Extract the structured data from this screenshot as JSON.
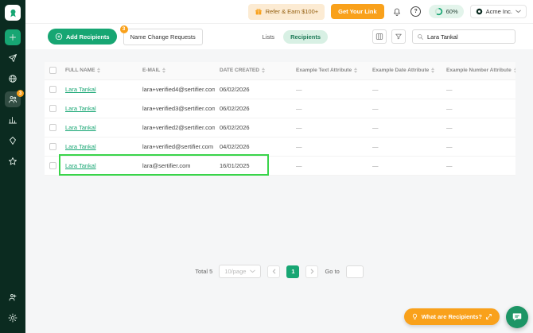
{
  "sidebar": {
    "icons": [
      "logo",
      "add",
      "send",
      "globe",
      "recipients",
      "analytics",
      "credentials",
      "star",
      "invite",
      "settings"
    ],
    "recipients_badge": "3"
  },
  "header": {
    "refer_button": "Refer & Earn $100+",
    "get_link_button": "Get Your Link",
    "help_icon": "?",
    "usage_percent": "60%",
    "org_name": "Acme Inc."
  },
  "toolbar": {
    "add_recipients": "Add Recipients",
    "name_change_requests": "Name Change Requests",
    "name_change_badge": "3",
    "tab_lists": "Lists",
    "tab_recipients": "Recipients",
    "search_value": "Lara Tankal"
  },
  "table": {
    "columns": [
      "FULL NAME",
      "E-MAIL",
      "DATE CREATED",
      "Example Text Attribute",
      "Example Date Attribute",
      "Example Number Attribute"
    ],
    "rows": [
      {
        "name": "Lara Tankal",
        "email": "lara+verified4@sertifier.com",
        "date": "06/02/2026",
        "text_attr": "—",
        "date_attr": "—",
        "number_attr": "—"
      },
      {
        "name": "Lara Tankal",
        "email": "lara+verified3@sertifier.com",
        "date": "06/02/2026",
        "text_attr": "—",
        "date_attr": "—",
        "number_attr": "—"
      },
      {
        "name": "Lara Tankal",
        "email": "lara+verified2@sertifier.com",
        "date": "06/02/2026",
        "text_attr": "—",
        "date_attr": "—",
        "number_attr": "—"
      },
      {
        "name": "Lara Tankal",
        "email": "lara+verified@sertifier.com",
        "date": "04/02/2026",
        "text_attr": "—",
        "date_attr": "—",
        "number_attr": "—"
      },
      {
        "name": "Lara Tankal",
        "email": "lara@sertifier.com",
        "date": "16/01/2025",
        "text_attr": "—",
        "date_attr": "—",
        "number_attr": "—"
      }
    ]
  },
  "pagination": {
    "total": "Total 5",
    "page_size": "10/page",
    "current_page": "1",
    "goto_label": "Go to"
  },
  "floating": {
    "help_button": "What are Recipients?"
  },
  "colors": {
    "brand_green": "#17A673",
    "sidebar_bg": "#0B2B20",
    "accent_orange": "#F9A11B",
    "light_green_pill": "#D8F0E4",
    "highlight_border": "#39D44A"
  }
}
